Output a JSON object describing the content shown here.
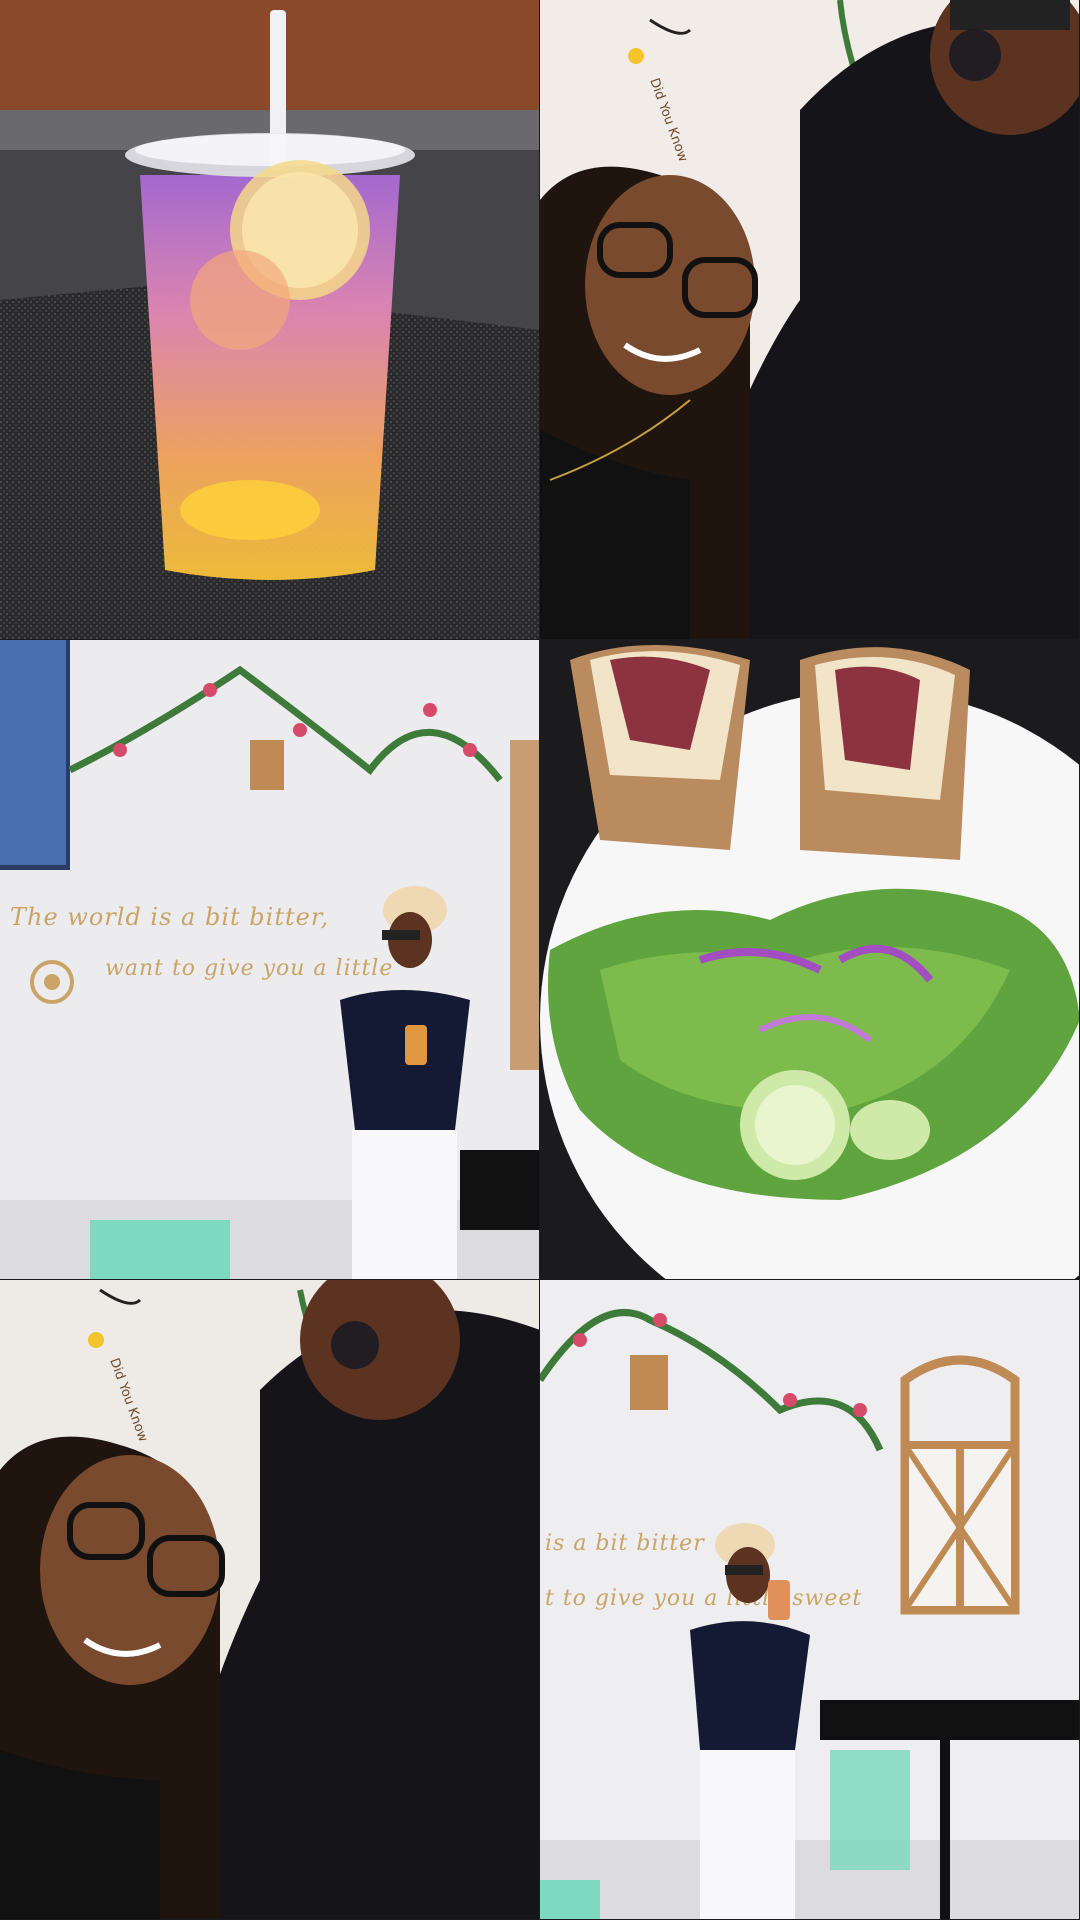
{
  "collage": {
    "tiles": [
      {
        "id": "drink",
        "subject": "iced-drink"
      },
      {
        "id": "selfie-top",
        "subject": "selfie"
      },
      {
        "id": "cafe-wall",
        "subject": "woman-by-wall"
      },
      {
        "id": "sandwich-plate",
        "subject": "food"
      },
      {
        "id": "selfie-bottom",
        "subject": "selfie"
      },
      {
        "id": "cafe-window",
        "subject": "woman-by-window"
      }
    ]
  },
  "wall_sign": {
    "line1": "The world is a bit bitter,",
    "line2": "want to give you a little",
    "line2_fragment": "want to give you",
    "line1_fragment": "is a bit bitter",
    "line2_fragment_right": "t to give you a little sweet"
  },
  "wall_small_text": {
    "label": "Did You Know"
  },
  "colors": {
    "wall": "#efeae6",
    "drink_top": "#b070d0",
    "drink_bottom": "#f5b030",
    "greenery": "#3e7a3a",
    "flowers": "#d64a6a",
    "chair_mint": "#7fd8c0",
    "wood": "#c08a55",
    "outfit_navy": "#141a33"
  }
}
